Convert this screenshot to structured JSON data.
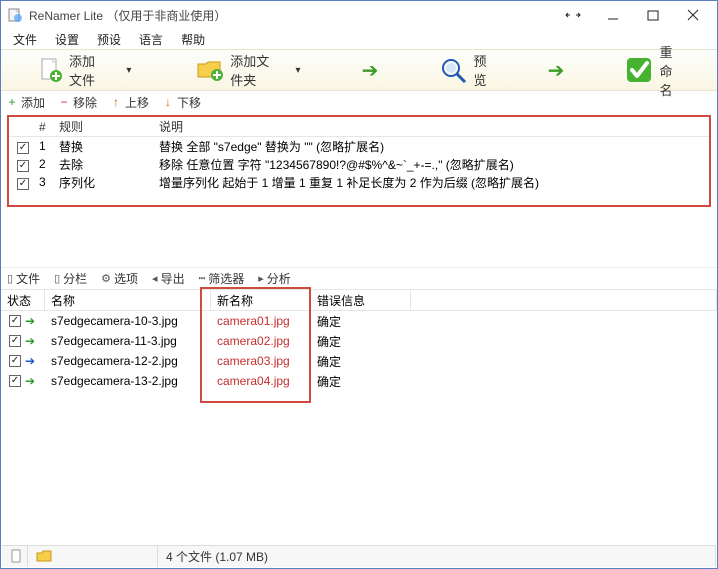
{
  "title": "ReNamer Lite （仅用于非商业使用）",
  "menus": [
    "文件",
    "设置",
    "预设",
    "语言",
    "帮助"
  ],
  "toolbar": {
    "add_files": "添加文件",
    "add_folder": "添加文件夹",
    "preview": "预览",
    "rename": "重命名"
  },
  "rules_toolbar": {
    "add": "添加",
    "remove": "移除",
    "up": "上移",
    "down": "下移"
  },
  "rules_header": {
    "idx": "#",
    "rule": "规则",
    "desc": "说明"
  },
  "rules": [
    {
      "idx": "1",
      "rule": "替换",
      "desc": "替换 全部 \"s7edge\" 替换为 \"\" (忽略扩展名)"
    },
    {
      "idx": "2",
      "rule": "去除",
      "desc": "移除 任意位置 字符 \"1234567890!?@#$%^&~`_+-=.,\" (忽略扩展名)"
    },
    {
      "idx": "3",
      "rule": "序列化",
      "desc": "增量序列化 起始于 1 增量 1 重复 1 补足长度为 2 作为后缀 (忽略扩展名)"
    }
  ],
  "files_toolbar": {
    "files": "文件",
    "columns": "分栏",
    "options": "选项",
    "export": "导出",
    "filter": "筛选器",
    "analyze": "分析"
  },
  "files_header": {
    "status": "状态",
    "name": "名称",
    "newname": "新名称",
    "error": "错误信息"
  },
  "files": [
    {
      "status_color": "green",
      "name": "s7edgecamera-10-3.jpg",
      "newname": "camera01.jpg",
      "error": "确定"
    },
    {
      "status_color": "green",
      "name": "s7edgecamera-11-3.jpg",
      "newname": "camera02.jpg",
      "error": "确定"
    },
    {
      "status_color": "blue",
      "name": "s7edgecamera-12-2.jpg",
      "newname": "camera03.jpg",
      "error": "确定"
    },
    {
      "status_color": "green",
      "name": "s7edgecamera-13-2.jpg",
      "newname": "camera04.jpg",
      "error": "确定"
    }
  ],
  "statusbar": {
    "count": "4 个文件 (1.07 MB)"
  }
}
